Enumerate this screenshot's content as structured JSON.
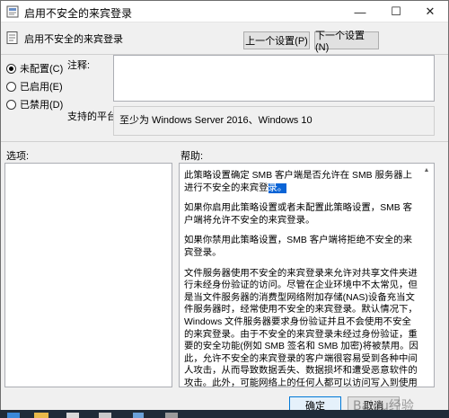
{
  "window": {
    "title": "启用不安全的来宾登录",
    "minimize_glyph": "—",
    "maximize_glyph": "☐",
    "close_glyph": "✕"
  },
  "header": {
    "policy_title": "启用不安全的来宾登录",
    "prev_button": "上一个设置(P)",
    "next_button": "下一个设置(N)"
  },
  "options": {
    "not_configured": "未配置(C)",
    "enabled": "已启用(E)",
    "disabled": "已禁用(D)",
    "selected": "not_configured"
  },
  "comment": {
    "label": "注释:",
    "value": ""
  },
  "support": {
    "label": "支持的平台:",
    "value": "至少为 Windows Server 2016、Windows 10"
  },
  "sections": {
    "options_label": "选项:",
    "help_label": "帮助:"
  },
  "help": {
    "p1_before": "此策略设置确定 SMB 客户端是否允许在 SMB 服务器上进行不安全的来宾登",
    "p1_selected": "录。",
    "p2": "如果你启用此策略设置或者未配置此策略设置，SMB 客户端将允许不安全的来宾登录。",
    "p3": "如果你禁用此策略设置，SMB 客户端将拒绝不安全的来宾登录。",
    "p4": "文件服务器使用不安全的来宾登录来允许对共享文件夹进行未经身份验证的访问。尽管在企业环境中不太常见，但是当文件服务器的消费型网络附加存储(NAS)设备充当文件服务器时，经常使用不安全的来宾登录。默认情况下，Windows 文件服务器要求身份验证并且不会使用不安全的来宾登录。由于不安全的来宾登录未经过身份验证，重要的安全功能(例如 SMB 签名和 SMB 加密)将被禁用。因此，允许不安全的来宾登录的客户端很容易受到各种中间人攻击，从而导致数据丢失、数据损坏和遭受恶意软件的攻击。此外，可能网络上的任何人都可以访问写入到使用不安全来宾登录的文件服务器中的任何数据。Microsoft 建议禁用不安全的来宾登录，并将文件服务器配置为要求经过身份验证的访问。"
  },
  "footer": {
    "ok_button": "确定",
    "cancel_button": "取消"
  },
  "watermark": "Baidu经验",
  "colors": {
    "selection": "#0a64d6",
    "default_button_border": "#0078d7",
    "taskbar": "#1f2b38"
  }
}
